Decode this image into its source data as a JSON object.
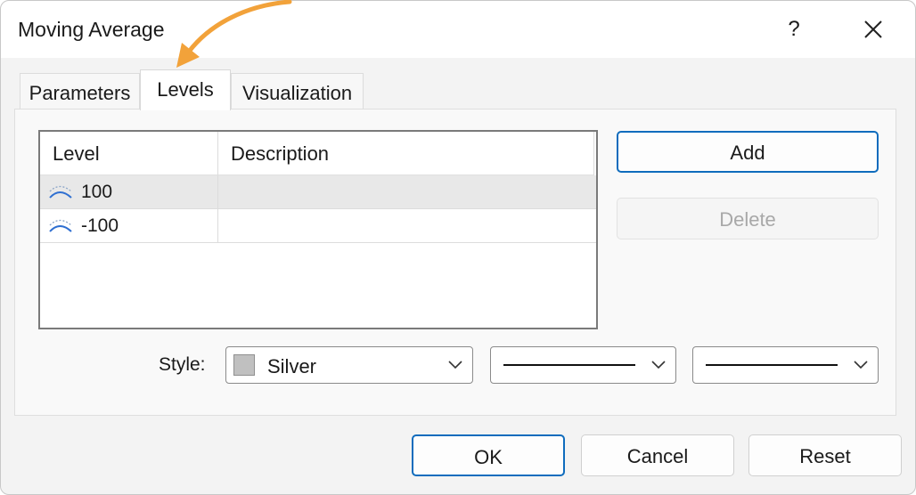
{
  "window": {
    "title": "Moving Average",
    "help_label": "?"
  },
  "tabs": [
    {
      "label": "Parameters",
      "active": false
    },
    {
      "label": "Levels",
      "active": true
    },
    {
      "label": "Visualization",
      "active": false
    }
  ],
  "levels_table": {
    "columns": [
      "Level",
      "Description"
    ],
    "rows": [
      {
        "level": "100",
        "description": "",
        "selected": true,
        "icon": "level-line-icon"
      },
      {
        "level": "-100",
        "description": "",
        "selected": false,
        "icon": "level-line-icon"
      }
    ]
  },
  "actions": {
    "add_label": "Add",
    "delete_label": "Delete",
    "delete_enabled": false
  },
  "style": {
    "label": "Style:",
    "color_name": "Silver",
    "color_hex": "#c0c0c0",
    "line_style": "solid",
    "line_width": "thin"
  },
  "footer": {
    "ok_label": "OK",
    "cancel_label": "Cancel",
    "reset_label": "Reset"
  },
  "colors": {
    "accent": "#0f6cbd",
    "arrow": "#f2a23a"
  }
}
